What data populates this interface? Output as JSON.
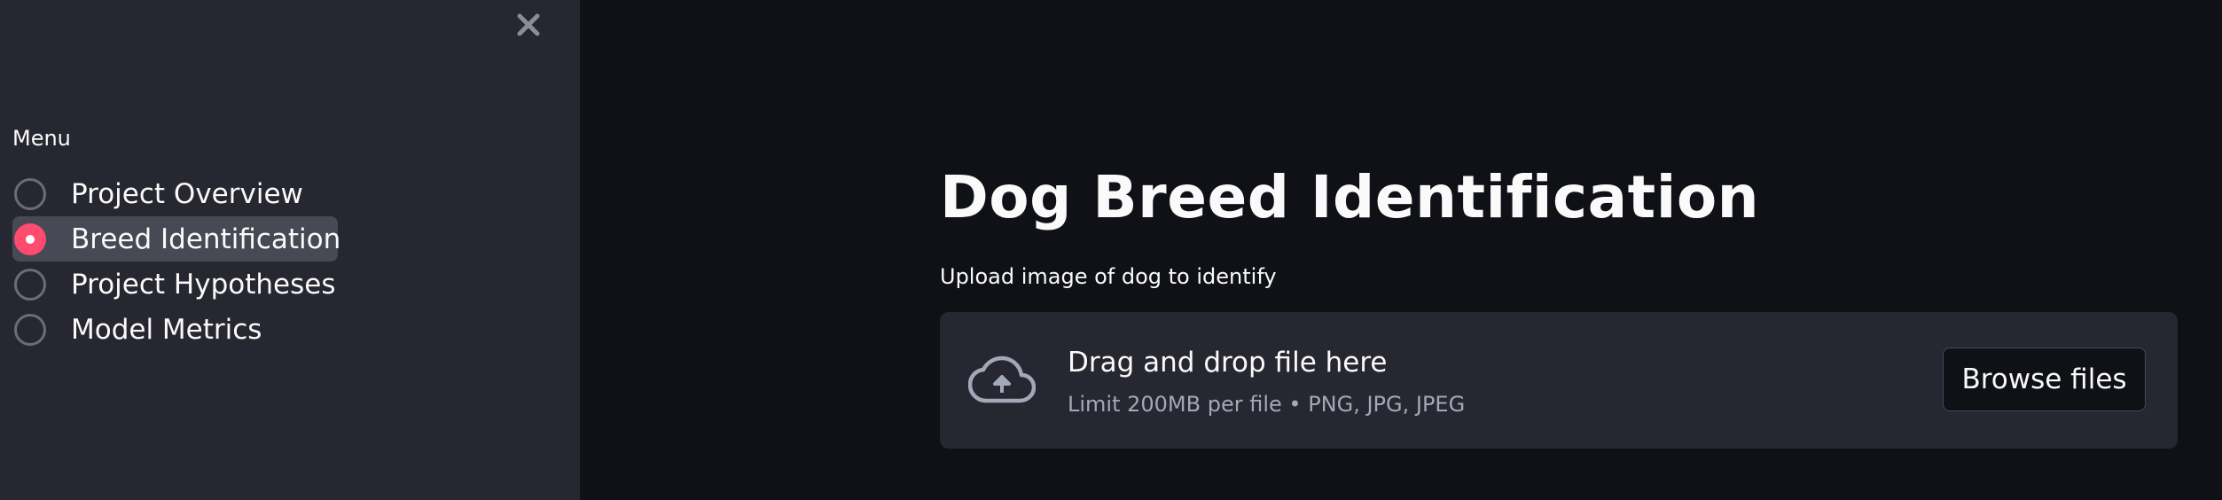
{
  "sidebar": {
    "close_icon": "close-icon",
    "menu_label": "Menu",
    "items": [
      {
        "label": "Project Overview",
        "selected": false
      },
      {
        "label": "Breed Identification",
        "selected": true
      },
      {
        "label": "Project Hypotheses",
        "selected": false
      },
      {
        "label": "Model Metrics",
        "selected": false
      }
    ]
  },
  "main": {
    "title": "Dog Breed Identification",
    "uploader": {
      "label": "Upload image of dog to identify",
      "icon": "cloud-upload-icon",
      "drop_text": "Drag and drop file here",
      "limit_text": "Limit 200MB per file • PNG, JPG, JPEG",
      "browse_label": "Browse files"
    }
  },
  "colors": {
    "background": "#0f1117",
    "sidebar": "#262730",
    "accent": "#ff4b6e",
    "text": "#fafafa",
    "muted_text": "#a3a8b8"
  }
}
